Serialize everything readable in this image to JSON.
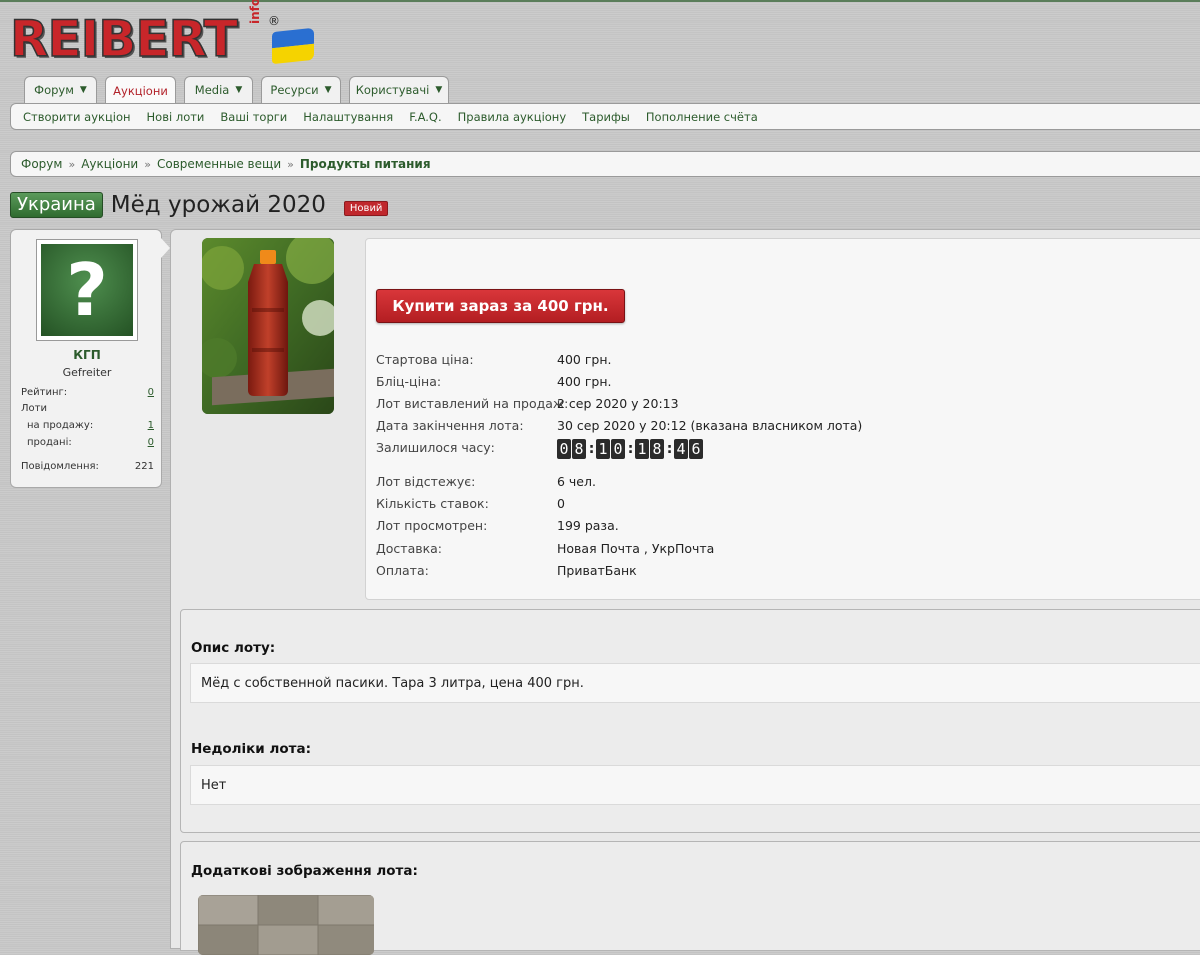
{
  "logo": {
    "text": "REIBERT",
    "suffix": "info",
    "reg": "®"
  },
  "tabs": [
    {
      "label": "Форум"
    },
    {
      "label": "Аукціони"
    },
    {
      "label": "Media"
    },
    {
      "label": "Ресурси"
    },
    {
      "label": "Користувачі"
    }
  ],
  "subnav": [
    "Створити аукціон",
    "Нові лоти",
    "Ваші торги",
    "Налаштування",
    "F.A.Q.",
    "Правила аукціону",
    "Тарифы",
    "Пополнение счёта"
  ],
  "breadcrumb": {
    "items": [
      "Форум",
      "Аукціони",
      "Современные вещи"
    ],
    "current": "Продукты питания",
    "separator": "»"
  },
  "lot": {
    "country": "Украина",
    "title": "Мёд урожай 2020",
    "badge": "Новий"
  },
  "seller": {
    "name": "КГП",
    "rank": "Gefreiter",
    "rating_label": "Рейтинг:",
    "rating": "0",
    "lots_label": "Лоти",
    "for_sale_label": "на продажу:",
    "for_sale": "1",
    "sold_label": "продані:",
    "sold": "0",
    "messages_label": "Повідомлення:",
    "messages": "221"
  },
  "buy_button": "Купити зараз за 400 грн.",
  "details": {
    "start_price_label": "Стартова ціна:",
    "start_price": "400 грн.",
    "blitz_label": "Бліц-ціна:",
    "blitz": "400 грн.",
    "listed_label": "Лот виставлений на продаж:",
    "listed": "2 сер 2020 у 20:13",
    "end_label": "Дата закінчення лота:",
    "end": "30 сер 2020 у 20:12 (вказана власником лота)",
    "remaining_label": "Залишилося часу:",
    "remaining": [
      "0",
      "8",
      "1",
      "0",
      "1",
      "8",
      "4",
      "6"
    ],
    "watch_label": "Лот відстежує:",
    "watch": "6 чел.",
    "bids_label": "Кількість ставок:",
    "bids": "0",
    "views_label": "Лот просмотрен:",
    "views": "199 раза.",
    "delivery_label": "Доставка:",
    "delivery": "Новая Почта , УкрПочта",
    "payment_label": "Оплата:",
    "payment": "ПриватБанк"
  },
  "description": {
    "heading": "Опис лоту:",
    "text": "Мёд с собственной пасики. Тара 3 литра, цена 400 грн."
  },
  "defects": {
    "heading": "Недоліки лота:",
    "text": "Нет"
  },
  "extra_images": {
    "heading": "Додаткові зображення лота:"
  },
  "colors": {
    "brand_green": "#2c5b2c",
    "accent_red": "#c0282d"
  }
}
